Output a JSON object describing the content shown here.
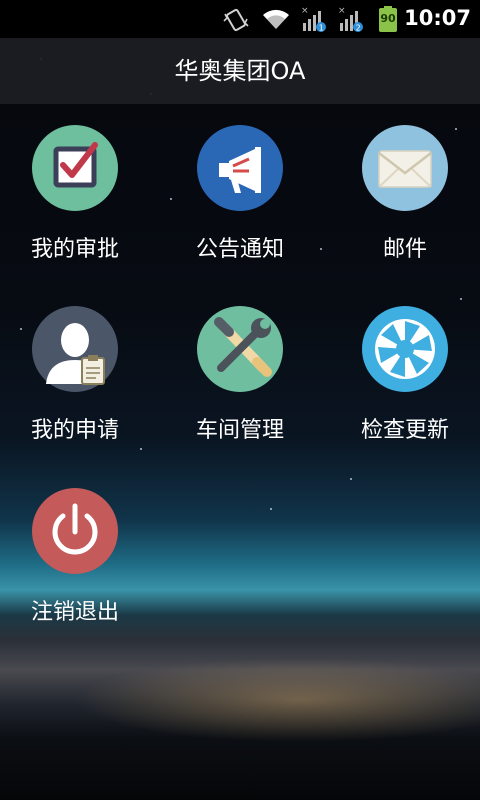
{
  "status_bar": {
    "time": "10:07",
    "battery_level": "90",
    "icons": [
      "vibrate-icon",
      "wifi-icon",
      "signal-sim1-icon",
      "signal-sim2-icon",
      "battery-icon"
    ]
  },
  "header": {
    "title": "华奥集团OA"
  },
  "colors": {
    "approval": "#6dbf9e",
    "announce": "#2a68b6",
    "mail": "#8fc2df",
    "request": "#4b5668",
    "workshop": "#6fbea0",
    "update": "#3faee0",
    "logout": "#c45a5a"
  },
  "menu": [
    {
      "label": "我的审批",
      "icon": "checkbox-icon"
    },
    {
      "label": "公告通知",
      "icon": "megaphone-icon"
    },
    {
      "label": "邮件",
      "icon": "envelope-icon"
    },
    {
      "label": "我的申请",
      "icon": "user-clipboard-icon"
    },
    {
      "label": "车间管理",
      "icon": "tools-icon"
    },
    {
      "label": "检查更新",
      "icon": "aperture-icon"
    },
    {
      "label": "注销退出",
      "icon": "power-icon"
    }
  ]
}
